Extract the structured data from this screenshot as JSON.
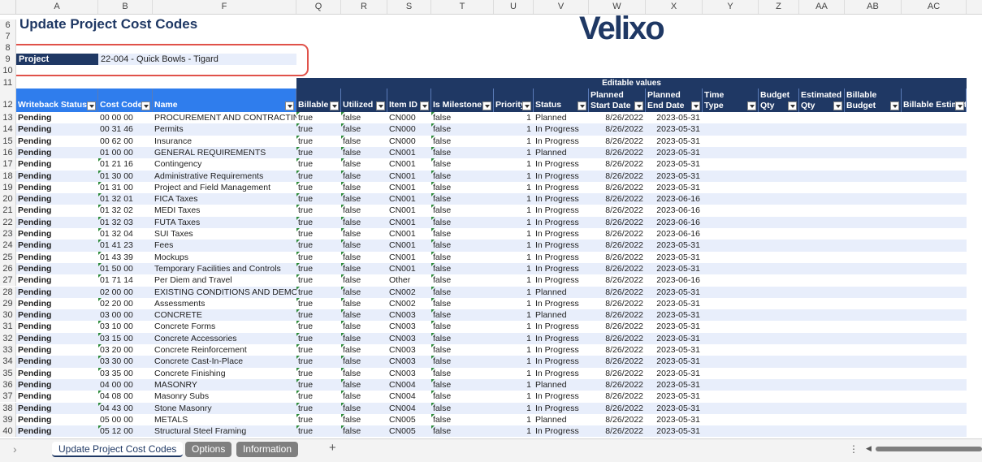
{
  "columns": [
    "A",
    "B",
    "F",
    "Q",
    "R",
    "S",
    "T",
    "U",
    "V",
    "W",
    "X",
    "Y",
    "Z",
    "AA",
    "AB",
    "AC"
  ],
  "rows_top": [
    "6",
    "7",
    "8",
    "9",
    "10",
    "11",
    "12"
  ],
  "title": "Update Project Cost Codes",
  "logo": "Velixo",
  "project": {
    "label": "Project",
    "value": "22-004 - Quick Bowls - Tigard"
  },
  "editable_band": "Editable values",
  "headers": [
    {
      "label": "Writeback Status"
    },
    {
      "label": "Cost Code"
    },
    {
      "label": "Name"
    },
    {
      "label": "Billable"
    },
    {
      "label": "Utilized"
    },
    {
      "label": "Item ID"
    },
    {
      "label": "Is Milestone?"
    },
    {
      "label": "Priority"
    },
    {
      "label": "Status"
    },
    {
      "label": "Planned Start Date"
    },
    {
      "label": "Planned End Date"
    },
    {
      "label": "Time Type"
    },
    {
      "label": "Budget Qty"
    },
    {
      "label": "Estimated Qty"
    },
    {
      "label": "Billable Budget Qty"
    },
    {
      "label": "Billable Estimated Q"
    }
  ],
  "rows": [
    {
      "n": "13",
      "ws": "Pending",
      "cc": "00 00 00",
      "name": "PROCUREMENT AND CONTRACTING",
      "bill": "true",
      "util": "false",
      "item": "CN000",
      "ms": "false",
      "pri": "1",
      "status": "Planned",
      "start": "8/26/2022",
      "end": "2023-05-31"
    },
    {
      "n": "14",
      "ws": "Pending",
      "cc": "00 31 46",
      "name": "Permits",
      "bill": "true",
      "util": "false",
      "item": "CN000",
      "ms": "false",
      "pri": "1",
      "status": "In Progress",
      "start": "8/26/2022",
      "end": "2023-05-31"
    },
    {
      "n": "15",
      "ws": "Pending",
      "cc": "00 62 00",
      "name": "Insurance",
      "bill": "true",
      "util": "false",
      "item": "CN000",
      "ms": "false",
      "pri": "1",
      "status": "In Progress",
      "start": "8/26/2022",
      "end": "2023-05-31"
    },
    {
      "n": "16",
      "ws": "Pending",
      "cc": "01 00 00",
      "name": "GENERAL REQUIREMENTS",
      "bill": "true",
      "util": "false",
      "item": "CN001",
      "ms": "false",
      "pri": "1",
      "status": "Planned",
      "start": "8/26/2022",
      "end": "2023-05-31"
    },
    {
      "n": "17",
      "ws": "Pending",
      "cc": "01 21 16",
      "name": "Contingency",
      "bill": "true",
      "util": "false",
      "item": "CN001",
      "ms": "false",
      "pri": "1",
      "status": "In Progress",
      "start": "8/26/2022",
      "end": "2023-05-31"
    },
    {
      "n": "18",
      "ws": "Pending",
      "cc": "01 30 00",
      "name": "Administrative Requirements",
      "bill": "true",
      "util": "false",
      "item": "CN001",
      "ms": "false",
      "pri": "1",
      "status": "In Progress",
      "start": "8/26/2022",
      "end": "2023-05-31"
    },
    {
      "n": "19",
      "ws": "Pending",
      "cc": "01 31 00",
      "name": "Project and Field Management",
      "bill": "true",
      "util": "false",
      "item": "CN001",
      "ms": "false",
      "pri": "1",
      "status": "In Progress",
      "start": "8/26/2022",
      "end": "2023-05-31"
    },
    {
      "n": "20",
      "ws": "Pending",
      "cc": "01 32 01",
      "name": "FICA Taxes",
      "bill": "true",
      "util": "false",
      "item": "CN001",
      "ms": "false",
      "pri": "1",
      "status": "In Progress",
      "start": "8/26/2022",
      "end": "2023-06-16"
    },
    {
      "n": "21",
      "ws": "Pending",
      "cc": "01 32 02",
      "name": "MEDI Taxes",
      "bill": "true",
      "util": "false",
      "item": "CN001",
      "ms": "false",
      "pri": "1",
      "status": "In Progress",
      "start": "8/26/2022",
      "end": "2023-06-16"
    },
    {
      "n": "22",
      "ws": "Pending",
      "cc": "01 32 03",
      "name": "FUTA Taxes",
      "bill": "true",
      "util": "false",
      "item": "CN001",
      "ms": "false",
      "pri": "1",
      "status": "In Progress",
      "start": "8/26/2022",
      "end": "2023-06-16"
    },
    {
      "n": "23",
      "ws": "Pending",
      "cc": "01 32 04",
      "name": "SUI Taxes",
      "bill": "true",
      "util": "false",
      "item": "CN001",
      "ms": "false",
      "pri": "1",
      "status": "In Progress",
      "start": "8/26/2022",
      "end": "2023-06-16"
    },
    {
      "n": "24",
      "ws": "Pending",
      "cc": "01 41 23",
      "name": "Fees",
      "bill": "true",
      "util": "false",
      "item": "CN001",
      "ms": "false",
      "pri": "1",
      "status": "In Progress",
      "start": "8/26/2022",
      "end": "2023-05-31"
    },
    {
      "n": "25",
      "ws": "Pending",
      "cc": "01 43 39",
      "name": "Mockups",
      "bill": "true",
      "util": "false",
      "item": "CN001",
      "ms": "false",
      "pri": "1",
      "status": "In Progress",
      "start": "8/26/2022",
      "end": "2023-05-31"
    },
    {
      "n": "26",
      "ws": "Pending",
      "cc": "01 50 00",
      "name": "Temporary Facilities and Controls",
      "bill": "true",
      "util": "false",
      "item": "CN001",
      "ms": "false",
      "pri": "1",
      "status": "In Progress",
      "start": "8/26/2022",
      "end": "2023-05-31"
    },
    {
      "n": "27",
      "ws": "Pending",
      "cc": "01 71 14",
      "name": "Per Diem and Travel",
      "bill": "true",
      "util": "false",
      "item": "Other",
      "ms": "false",
      "pri": "1",
      "status": "In Progress",
      "start": "8/26/2022",
      "end": "2023-06-16"
    },
    {
      "n": "28",
      "ws": "Pending",
      "cc": "02 00 00",
      "name": "EXISTING CONDITIONS AND DEMO",
      "bill": "true",
      "util": "false",
      "item": "CN002",
      "ms": "false",
      "pri": "1",
      "status": "Planned",
      "start": "8/26/2022",
      "end": "2023-05-31"
    },
    {
      "n": "29",
      "ws": "Pending",
      "cc": "02 20 00",
      "name": "Assessments",
      "bill": "true",
      "util": "false",
      "item": "CN002",
      "ms": "false",
      "pri": "1",
      "status": "In Progress",
      "start": "8/26/2022",
      "end": "2023-05-31"
    },
    {
      "n": "30",
      "ws": "Pending",
      "cc": "03 00 00",
      "name": "CONCRETE",
      "bill": "true",
      "util": "false",
      "item": "CN003",
      "ms": "false",
      "pri": "1",
      "status": "Planned",
      "start": "8/26/2022",
      "end": "2023-05-31"
    },
    {
      "n": "31",
      "ws": "Pending",
      "cc": "03 10 00",
      "name": "Concrete Forms",
      "bill": "true",
      "util": "false",
      "item": "CN003",
      "ms": "false",
      "pri": "1",
      "status": "In Progress",
      "start": "8/26/2022",
      "end": "2023-05-31"
    },
    {
      "n": "32",
      "ws": "Pending",
      "cc": "03 15 00",
      "name": "Concrete Accessories",
      "bill": "true",
      "util": "false",
      "item": "CN003",
      "ms": "false",
      "pri": "1",
      "status": "In Progress",
      "start": "8/26/2022",
      "end": "2023-05-31"
    },
    {
      "n": "33",
      "ws": "Pending",
      "cc": "03 20 00",
      "name": "Concrete Reinforcement",
      "bill": "true",
      "util": "false",
      "item": "CN003",
      "ms": "false",
      "pri": "1",
      "status": "In Progress",
      "start": "8/26/2022",
      "end": "2023-05-31"
    },
    {
      "n": "34",
      "ws": "Pending",
      "cc": "03 30 00",
      "name": "Concrete Cast-In-Place",
      "bill": "true",
      "util": "false",
      "item": "CN003",
      "ms": "false",
      "pri": "1",
      "status": "In Progress",
      "start": "8/26/2022",
      "end": "2023-05-31"
    },
    {
      "n": "35",
      "ws": "Pending",
      "cc": "03 35 00",
      "name": "Concrete Finishing",
      "bill": "true",
      "util": "false",
      "item": "CN003",
      "ms": "false",
      "pri": "1",
      "status": "In Progress",
      "start": "8/26/2022",
      "end": "2023-05-31"
    },
    {
      "n": "36",
      "ws": "Pending",
      "cc": "04 00 00",
      "name": "MASONRY",
      "bill": "true",
      "util": "false",
      "item": "CN004",
      "ms": "false",
      "pri": "1",
      "status": "Planned",
      "start": "8/26/2022",
      "end": "2023-05-31"
    },
    {
      "n": "37",
      "ws": "Pending",
      "cc": "04 08 00",
      "name": "Masonry Subs",
      "bill": "true",
      "util": "false",
      "item": "CN004",
      "ms": "false",
      "pri": "1",
      "status": "In Progress",
      "start": "8/26/2022",
      "end": "2023-05-31"
    },
    {
      "n": "38",
      "ws": "Pending",
      "cc": "04 43 00",
      "name": "Stone Masonry",
      "bill": "true",
      "util": "false",
      "item": "CN004",
      "ms": "false",
      "pri": "1",
      "status": "In Progress",
      "start": "8/26/2022",
      "end": "2023-05-31"
    },
    {
      "n": "39",
      "ws": "Pending",
      "cc": "05 00 00",
      "name": "METALS",
      "bill": "true",
      "util": "false",
      "item": "CN005",
      "ms": "false",
      "pri": "1",
      "status": "Planned",
      "start": "8/26/2022",
      "end": "2023-05-31"
    },
    {
      "n": "40",
      "ws": "Pending",
      "cc": "05 12 00",
      "name": "Structural Steel Framing",
      "bill": "true",
      "util": "false",
      "item": "CN005",
      "ms": "false",
      "pri": "1",
      "status": "In Progress",
      "start": "8/26/2022",
      "end": "2023-05-31"
    }
  ],
  "tabs": [
    "Update Project Cost Codes",
    "Options",
    "Information"
  ],
  "add_tab": "+",
  "more_icon": "⋮",
  "colors": {
    "navy": "#1f3864",
    "blue": "#2f7ded",
    "band": "#e8eefb",
    "highlight": "#e0524a",
    "flag": "#2e8b3b"
  }
}
